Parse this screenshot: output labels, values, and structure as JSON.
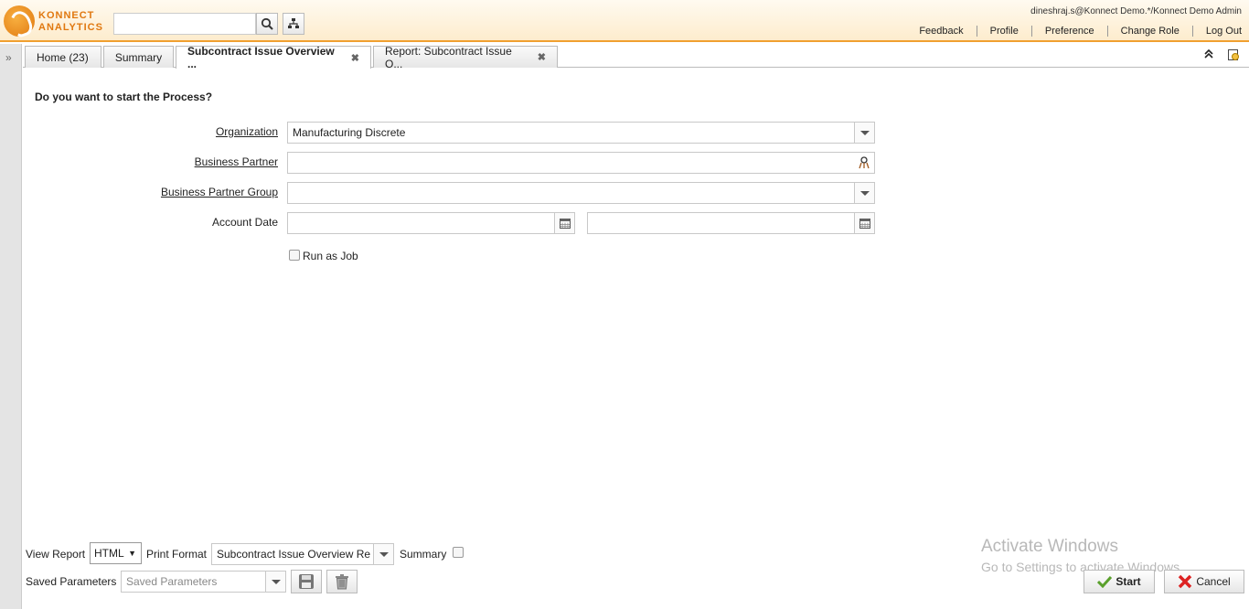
{
  "app": {
    "logo_line1": "KONNECT",
    "logo_line2": "ANALYTICS"
  },
  "header": {
    "user": "dineshraj.s@Konnect Demo.*/Konnect Demo Admin",
    "links": [
      "Feedback",
      "Profile",
      "Preference",
      "Change Role",
      "Log Out"
    ]
  },
  "tabs": [
    {
      "label": "Home (23)",
      "closable": false
    },
    {
      "label": "Summary",
      "closable": false
    },
    {
      "label": "Subcontract Issue Overview ...",
      "closable": true,
      "active": true
    },
    {
      "label": "Report: Subcontract Issue O...",
      "closable": true
    }
  ],
  "form": {
    "question": "Do you want to start the Process?",
    "organization_label": "Organization",
    "organization_value": "Manufacturing Discrete",
    "bp_label": "Business Partner",
    "bp_value": "",
    "bpg_label": "Business Partner Group",
    "bpg_value": "",
    "account_date_label": "Account Date",
    "date_from": "",
    "date_to": "",
    "run_as_job_label": "Run as Job",
    "run_as_job_checked": false
  },
  "bottom": {
    "view_report_label": "View Report",
    "view_report_value": "HTML",
    "print_format_label": "Print Format",
    "print_format_value": "Subcontract Issue Overview Re",
    "summary_label": "Summary",
    "saved_params_label": "Saved Parameters",
    "saved_params_placeholder": "Saved Parameters",
    "start_label": "Start",
    "cancel_label": "Cancel"
  },
  "watermark": {
    "line1": "Activate Windows",
    "line2": "Go to Settings to activate Windows."
  },
  "colors": {
    "accent": "#f0a030",
    "start_check": "#5aa02c",
    "cancel_x": "#d22"
  }
}
